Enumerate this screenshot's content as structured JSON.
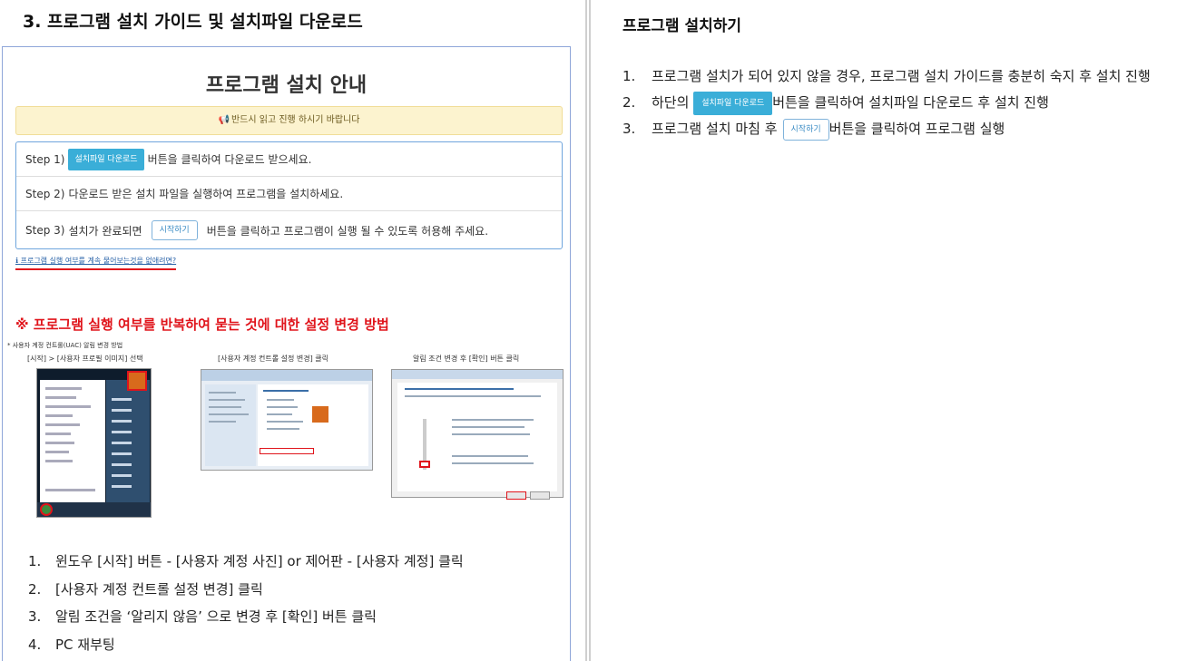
{
  "left": {
    "section_title": "3. 프로그램 설치 가이드 및 설치파일 다운로드",
    "guide": {
      "title": "프로그램 설치 안내",
      "notice": "반드시 읽고 진행 하시기 바랍니다",
      "steps": [
        {
          "label": "Step 1)",
          "button": "설치파일 다운로드",
          "text": "버튼을 클릭하여 다운로드 받으세요."
        },
        {
          "label": "Step 2)",
          "text": "다운로드 받은 설치 파일을 실행하여 프로그램을 설치하세요."
        },
        {
          "label": "Step 3)",
          "text_before": "설치가 완료되면",
          "button": "시작하기",
          "text_after": "버튼을 클릭하고 프로그램이 실행 될 수 있도록 허용해 주세요."
        }
      ],
      "help_link": "프로그램 실행 여부를 계속 물어보는것을 없애려면?",
      "red_heading": "※ 프로그램 실행 여부를 반복하여 묻는 것에 대한 설정 변경 방법",
      "uac_note": "* 사용자 계정 컨트롤(UAC) 알림 변경 방법",
      "captions": [
        "[시작] > [사용자 프로필 이미지] 선택",
        "[사용자 계정 컨트롤 설정 변경] 클릭",
        "알림 조건 변경 후 [확인] 버튼 클릭"
      ]
    },
    "list": [
      {
        "num": "1.",
        "text": "윈도우 [시작] 버튼 - [사용자 계정 사진] or 제어판 - [사용자 계정] 클릭"
      },
      {
        "num": "2.",
        "text": "[사용자 계정 컨트롤 설정 변경] 클릭"
      },
      {
        "num": "3.",
        "text": "알림 조건을 ‘알리지 않음’ 으로 변경 후 [확인] 버튼 클릭"
      },
      {
        "num": "4.",
        "text": "PC 재부팅"
      }
    ]
  },
  "right": {
    "title": "프로그램 설치하기",
    "items": [
      {
        "num": "1.",
        "text": "프로그램 설치가 되어 있지 않을 경우, 프로그램 설치 가이드를 충분히 숙지 후 설치 진행"
      },
      {
        "num": "2.",
        "before": "하단의",
        "button": "설치파일 다운로드",
        "after": "버튼을 클릭하여 설치파일 다운로드 후 설치 진행"
      },
      {
        "num": "3.",
        "before": "프로그램 설치 마침 후",
        "button": "시작하기",
        "after": "버튼을 클릭하여 프로그램 실행"
      }
    ]
  },
  "icons": {
    "notice": "megaphone-icon",
    "help": "info-circle-icon"
  },
  "colors": {
    "accent_blue": "#3aaed8",
    "warning_red": "#e0141b",
    "notice_bg": "#fcf3cf",
    "frame_border": "#8fa6d9"
  }
}
